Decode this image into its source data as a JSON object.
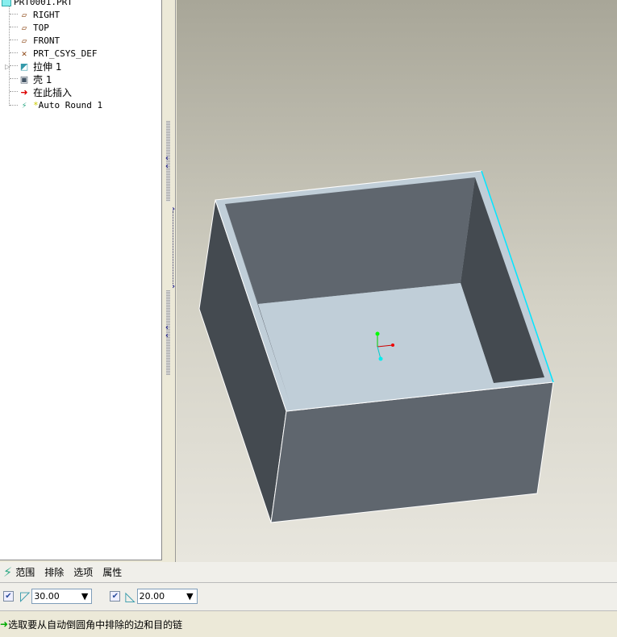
{
  "tree": {
    "root": "PRT0001.PRT",
    "items": [
      {
        "label": "RIGHT",
        "icon": "datum-plane-icon"
      },
      {
        "label": "TOP",
        "icon": "datum-plane-icon"
      },
      {
        "label": "FRONT",
        "icon": "datum-plane-icon"
      },
      {
        "label": "PRT_CSYS_DEF",
        "icon": "csys-icon"
      },
      {
        "label": "拉伸 1",
        "icon": "extrude-icon"
      },
      {
        "label": "壳 1",
        "icon": "shell-icon"
      },
      {
        "label": "在此插入",
        "icon": "insert-here-arrow-icon"
      },
      {
        "label": "Auto Round 1",
        "icon": "auto-round-icon"
      }
    ]
  },
  "dashboard": {
    "tabs": [
      "范围",
      "排除",
      "选项",
      "属性"
    ],
    "convex_value": "30.00",
    "concave_value": "20.00",
    "convex_checked": true,
    "concave_checked": true
  },
  "status": {
    "message": "选取要从自动倒圆角中排除的边和目的链"
  },
  "colors": {
    "highlight_edge": "#00e5ff",
    "face_dark": "#444a50",
    "face_mid": "#5f666e",
    "floor": "#c0ced8"
  }
}
